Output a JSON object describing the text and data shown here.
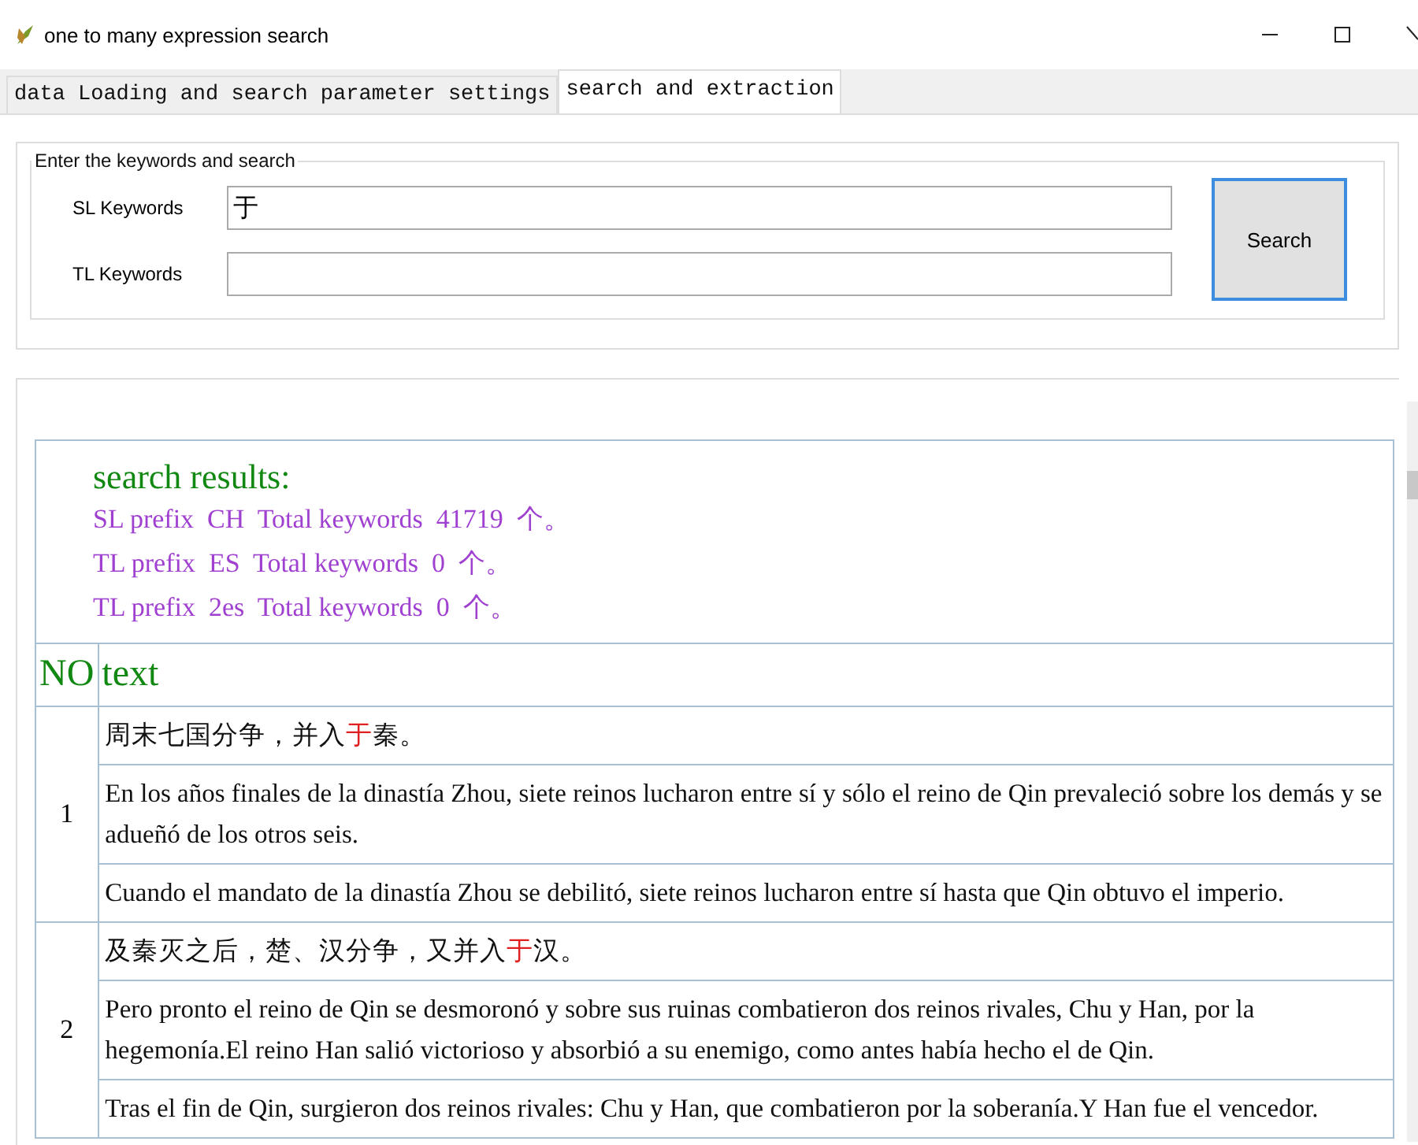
{
  "window": {
    "title": "one to many expression search"
  },
  "tabs": [
    {
      "label": "data Loading and search parameter settings",
      "selected": false
    },
    {
      "label": "search and extraction",
      "selected": true
    }
  ],
  "search_group": {
    "title": "Enter the keywords and search",
    "fields": [
      {
        "label": "SL Keywords",
        "value": "于"
      },
      {
        "label": "TL Keywords"
      }
    ],
    "button": "Search"
  },
  "results": {
    "heading": "search results:",
    "summary": [
      "SL prefix  CH  Total keywords  41719  个。",
      "TL prefix  ES  Total keywords  0  个。",
      "TL prefix  2es  Total keywords  0  个。"
    ],
    "columns": [
      "NO",
      "text"
    ],
    "rows": [
      {
        "no": "1",
        "lines": [
          {
            "parts": [
              {
                "text": "周末七国分争，并入",
                "highlight": false
              },
              {
                "text": "于",
                "highlight": true
              },
              {
                "text": "秦。",
                "highlight": false
              }
            ]
          },
          {
            "parts": [
              {
                "text": "En los años finales de la dinastía Zhou, siete reinos lucharon entre sí y sólo el reino de Qin prevaleció sobre los demás y se adueñó de los otros seis.",
                "highlight": false
              }
            ]
          },
          {
            "parts": [
              {
                "text": "Cuando el mandato de la dinastía Zhou se debilitó, siete reinos lucharon entre sí hasta que Qin obtuvo el imperio.",
                "highlight": false
              }
            ]
          }
        ]
      },
      {
        "no": "2",
        "lines": [
          {
            "parts": [
              {
                "text": "及秦灭之后，楚、汉分争，又并入",
                "highlight": false
              },
              {
                "text": "于",
                "highlight": true
              },
              {
                "text": "汉。",
                "highlight": false
              }
            ]
          },
          {
            "parts": [
              {
                "text": "Pero pronto el reino de Qin se desmoronó y sobre sus ruinas combatieron dos reinos rivales, Chu y Han, por la hegemonía.El reino Han salió victorioso y absorbió a su enemigo, como antes había hecho el de Qin.",
                "highlight": false
              }
            ]
          },
          {
            "parts": [
              {
                "text": "Tras el fin de Qin, surgieron dos reinos rivales: Chu y Han, que combatieron por la soberanía.Y Han fue el vencedor.",
                "highlight": false
              }
            ]
          }
        ]
      }
    ]
  }
}
